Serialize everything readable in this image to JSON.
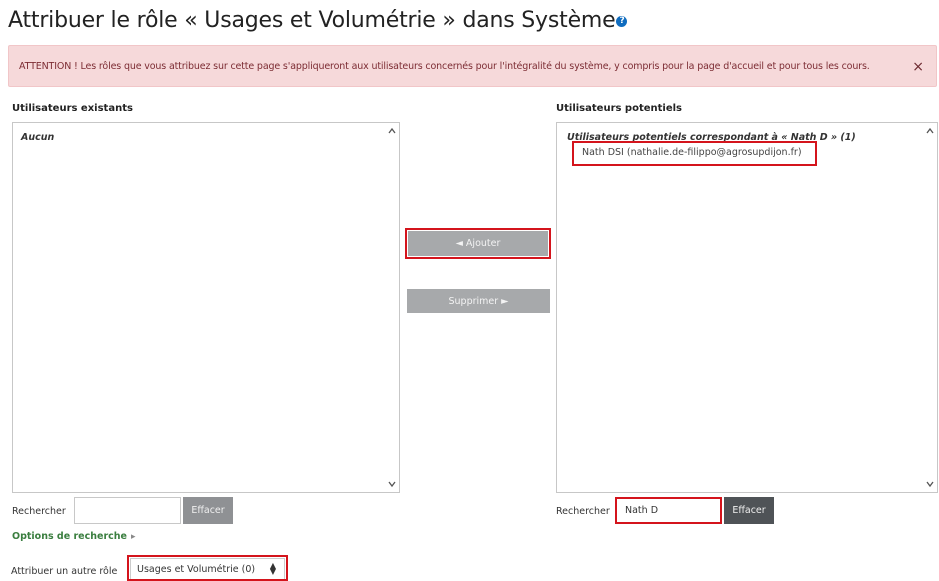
{
  "header": {
    "title": "Attribuer le rôle « Usages et Volumétrie » dans Système",
    "help_icon": "question-circle-icon"
  },
  "alert": {
    "text": "ATTENTION ! Les rôles que vous attribuez sur cette page s'appliqueront aux utilisateurs concernés pour l'intégralité du système, y compris pour la page d'accueil et pour tous les cours.",
    "close_glyph": "×"
  },
  "existing_users": {
    "title": "Utilisateurs existants",
    "empty_label": "Aucun",
    "search_label": "Rechercher",
    "search_value": "",
    "clear_label": "Effacer"
  },
  "actions": {
    "add_label": "◄ Ajouter",
    "remove_label": "Supprimer ►"
  },
  "potential_users": {
    "title": "Utilisateurs potentiels",
    "group_label": "Utilisateurs potentiels correspondant à « Nath D » (1)",
    "options": [
      "Nath DSI (nathalie.de-filippo@agrosupdijon.fr)"
    ],
    "search_label": "Rechercher",
    "search_value": "Nath D",
    "clear_label": "Effacer"
  },
  "search_options": {
    "label": "Options de recherche",
    "caret": "▸"
  },
  "other_role": {
    "label": "Attribuer un autre rôle",
    "selected": "Usages et Volumétrie (0)"
  },
  "colors": {
    "highlight": "#d4141c",
    "button_gray": "#a7a9ab",
    "clear_button": "#8f9194",
    "clear_button_active": "#4f5357",
    "alert_bg": "#f6d9da",
    "link_green": "#3a7e3f"
  }
}
